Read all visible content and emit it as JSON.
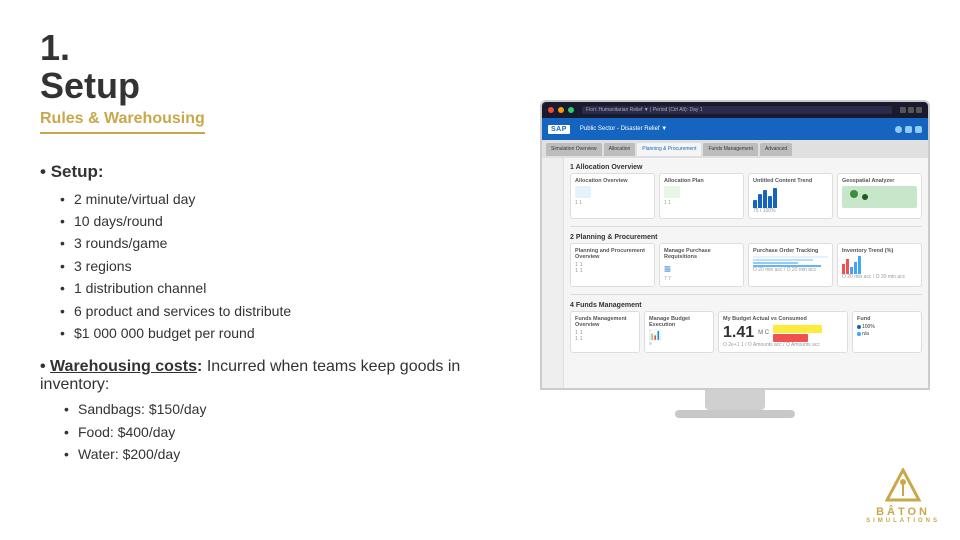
{
  "heading": {
    "number": "1.",
    "title": "Setup",
    "subtitle": "Rules & Warehousing"
  },
  "setup_section": {
    "label": "Setup:",
    "bullet_prefix": "• ",
    "bullets": [
      "2 minute/virtual day",
      "10 days/round",
      "3 rounds/game",
      "3 regions",
      "1 distribution channel",
      "6 product and services to distribute",
      "$1 000 000 budget per round"
    ]
  },
  "warehousing_section": {
    "label": "Warehousing costs",
    "description": "Incurred when teams keep goods in inventory:",
    "bullets": [
      "Sandbags: $150/day",
      "Food: $400/day",
      "Water: $200/day"
    ]
  },
  "sap_ui": {
    "tabs": [
      "Simulation Overview",
      "Allocation",
      "Planning & Procurement",
      "Funds Management",
      "Advanced"
    ],
    "active_tab": "Planning & Procurement",
    "sections": [
      {
        "title": "1 Allocation Overview",
        "cards": [
          {
            "title": "Allocation Overview",
            "value": ""
          },
          {
            "title": "Allocation Plan",
            "value": ""
          },
          {
            "title": "Untitled Content Trend",
            "value": "75"
          },
          {
            "title": "Geospatial Analyzer",
            "value": ""
          }
        ]
      },
      {
        "title": "2 Planning & Procurement",
        "cards": [
          {
            "title": "Planning and Procurement Overview",
            "value": ""
          },
          {
            "title": "Manage Purchase Requisitions",
            "value": ""
          },
          {
            "title": "Purchase Order Tracking",
            "value": ""
          },
          {
            "title": "Inventory Trend (%)",
            "value": ""
          }
        ]
      },
      {
        "title": "4 Funds Management",
        "cards": [
          {
            "title": "Funds Management Overview",
            "value": ""
          },
          {
            "title": "Manage Budget Execution",
            "value": ""
          },
          {
            "title": "My Budget Actual vs Consumed",
            "value": "1.41"
          },
          {
            "title": "Fund",
            "value": ""
          }
        ]
      }
    ]
  },
  "baton_logo": {
    "text": "BÂTON",
    "subtext": "SIMULATIONS"
  }
}
